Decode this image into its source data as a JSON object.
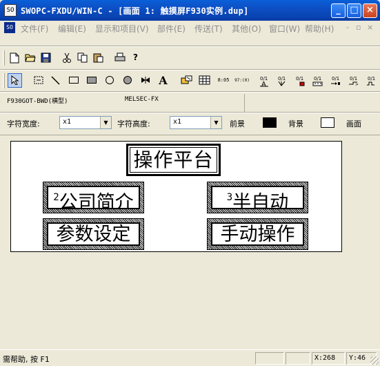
{
  "window": {
    "title": "SWOPC-FXDU/WIN-C - [画面 1: 触摸屏F930实例.dup]",
    "app_icon": "SO",
    "controls": {
      "minimize": "_",
      "maximize": "□",
      "close": "×"
    }
  },
  "menu": {
    "mdi_icon": "SO",
    "items": [
      {
        "label": "文件(F)"
      },
      {
        "label": "编辑(E)"
      },
      {
        "label": "显示和项目(V)"
      },
      {
        "label": "部件(E)"
      },
      {
        "label": "传送(T)"
      },
      {
        "label": "其他(O)"
      },
      {
        "label": "窗口(W)"
      },
      {
        "label": "帮助(H)"
      }
    ],
    "mdi_controls": {
      "minimize": "-",
      "restore": "▫",
      "close": "×"
    }
  },
  "toolbar1": {
    "icons": [
      "new-file-icon",
      "open-folder-icon",
      "save-icon",
      "cut-icon",
      "copy-icon",
      "paste-icon",
      "print-icon",
      "help-icon"
    ]
  },
  "toolbar2": {
    "icons": [
      "select-arrow-icon",
      "dotted-rect-icon",
      "line-icon",
      "rectangle-icon",
      "filled-rectangle-icon",
      "circle-icon",
      "filled-circle-icon",
      "bowtie-icon",
      "text-icon",
      "image-icon",
      "table-icon",
      "numeric-display-icon",
      "ascii-display-icon",
      "alpha-touch-icon",
      "touch-key-icon",
      "lamp-icon",
      "bar-graph-icon",
      "set-output-icon",
      "reset-output-icon",
      "alternate-icon",
      "momentary-icon"
    ],
    "labels": {
      "numeric": "8:05",
      "ascii": "97:(0)",
      "alpha": "A"
    }
  },
  "info": {
    "model": "F930GOT-BWD(横型)",
    "plc": "MELSEC-FX"
  },
  "properties": {
    "char_width_label": "字符宽度:",
    "char_width_value": "x1",
    "char_height_label": "字符高度:",
    "char_height_value": "x1",
    "foreground_label": "前景",
    "foreground_color": "#000000",
    "background_label": "背景",
    "background_color": "#ffffff",
    "screen_label": "画面"
  },
  "screen": {
    "title": "操作平台",
    "buttons": [
      {
        "label": "公司简介",
        "prefix": "2"
      },
      {
        "label": "半自动",
        "prefix": "3"
      },
      {
        "label": "参数设定",
        "prefix": ""
      },
      {
        "label": "手动操作",
        "prefix": ""
      }
    ]
  },
  "status": {
    "help_text": "需帮助, 按 F1",
    "x": "X:268",
    "y": "Y:46"
  }
}
